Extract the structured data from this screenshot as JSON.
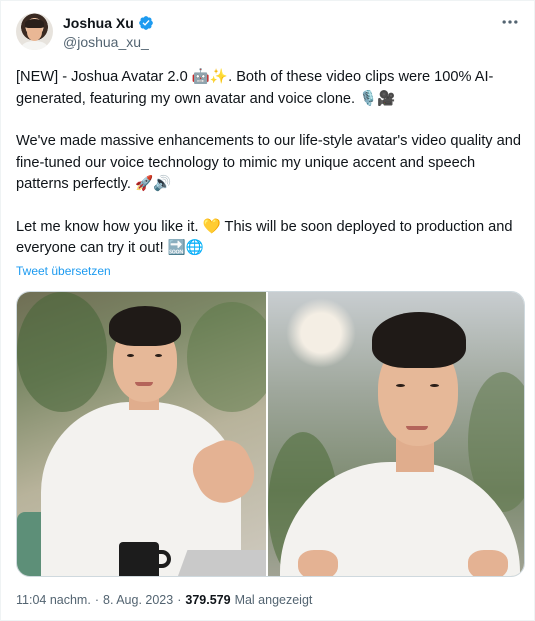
{
  "author": {
    "display_name": "Joshua Xu",
    "handle": "@joshua_xu_",
    "verified": true
  },
  "more_icon": "more-horizontal-icon",
  "tweet": {
    "paragraph1": "[NEW] - Joshua Avatar 2.0 🤖✨. Both of these video clips were 100% AI-generated, featuring my own avatar and voice clone. 🎙️🎥",
    "paragraph2": "We've made massive enhancements to our life-style avatar's video quality and fine-tuned our voice technology to mimic my unique accent and speech patterns perfectly. 🚀🔊",
    "paragraph3": "Let me know how you like it. 💛 This will be soon deployed to production and everyone can try it out! 🔜🌐"
  },
  "translate_label": "Tweet übersetzen",
  "media": {
    "count": 2,
    "items": [
      "video-clip-left",
      "video-clip-right"
    ]
  },
  "footer": {
    "time": "11:04 nachm.",
    "separator": "·",
    "date": "8. Aug. 2023",
    "views": "379.579",
    "views_label": "Mal angezeigt"
  },
  "colors": {
    "link": "#1d9bf0",
    "secondary_text": "#536471",
    "verified_badge": "#1d9bf0"
  }
}
